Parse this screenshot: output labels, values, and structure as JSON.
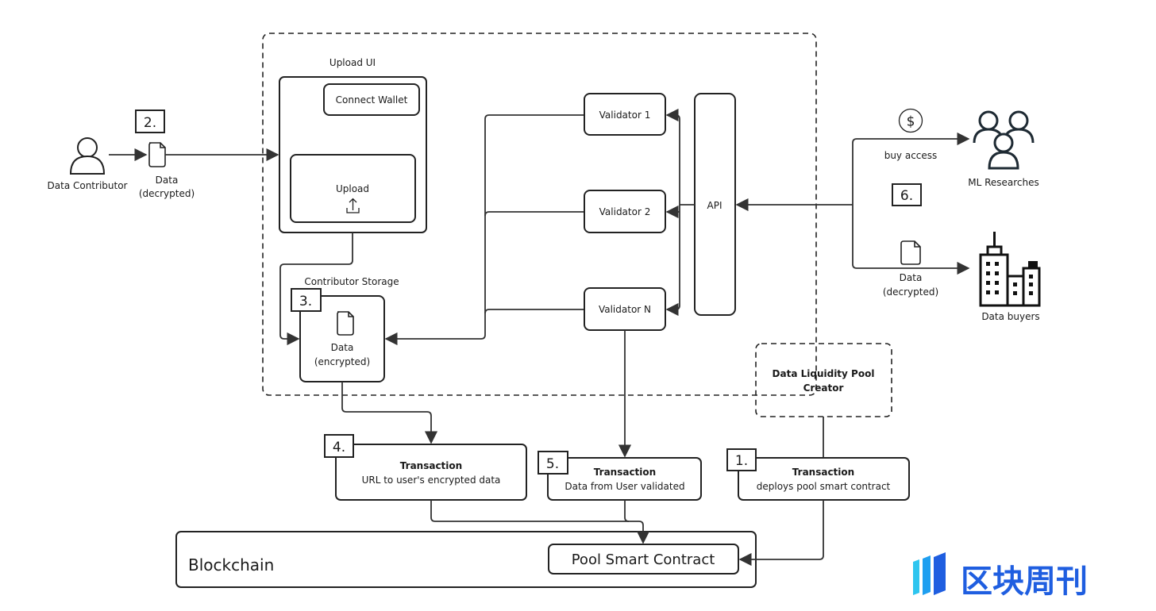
{
  "upload_ui": {
    "title": "Upload UI",
    "connect_wallet": "Connect Wallet",
    "upload": "Upload"
  },
  "contributor": {
    "label": "Data Contributor"
  },
  "step2": {
    "number": "2.",
    "label_line1": "Data",
    "label_line2": "(decrypted)"
  },
  "storage": {
    "title": "Contributor Storage",
    "number": "3.",
    "label_line1": "Data",
    "label_line2": "(encrypted)"
  },
  "validators": [
    "Validator 1",
    "Validator 2",
    "Validator N"
  ],
  "api": {
    "label": "API"
  },
  "step6": {
    "number": "6.",
    "buy_access": "buy access",
    "data_line1": "Data",
    "data_line2": "(decrypted)"
  },
  "consumers": {
    "ml": "ML Researches",
    "buyers": "Data buyers"
  },
  "pool_creator": {
    "line1": "Data Liquidity Pool",
    "line2": "Creator"
  },
  "transactions": [
    {
      "number": "4.",
      "title": "Transaction",
      "desc": "URL to user's encrypted data"
    },
    {
      "number": "5.",
      "title": "Transaction",
      "desc": "Data from User validated"
    },
    {
      "number": "1.",
      "title": "Transaction",
      "desc": "deploys pool smart contract"
    }
  ],
  "blockchain": {
    "label": "Blockchain",
    "contract": "Pool Smart Contract"
  },
  "watermark": {
    "text": "区块周刊",
    "color": "#1f5ee0",
    "accent": "#2ec5ef"
  }
}
